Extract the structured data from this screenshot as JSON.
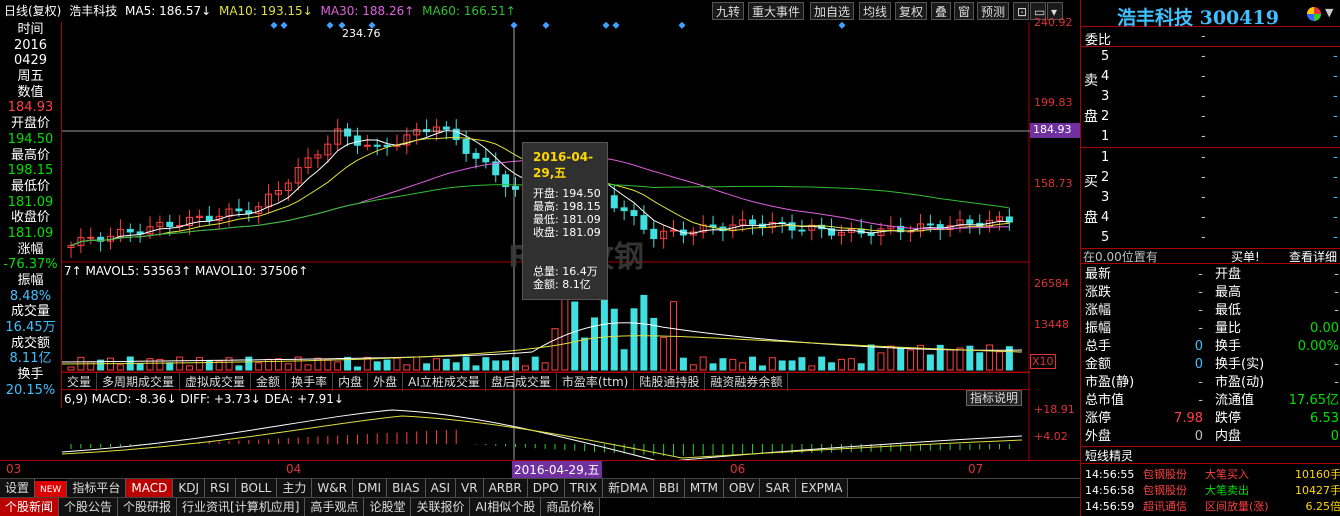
{
  "header": {
    "period": "日线(复权)",
    "stock": "浩丰科技",
    "ma5": "MA5: 186.57↓",
    "ma10": "MA10: 193.15↓",
    "ma30": "MA30: 188.26↑",
    "ma60": "MA60: 166.51↑",
    "toolbar": [
      "九转",
      "重大事件",
      "加自选",
      "均线",
      "复权",
      "叠",
      "窗",
      "预测"
    ]
  },
  "left_panel": {
    "lines": [
      {
        "text": "时间",
        "color": "#ffffff"
      },
      {
        "text": "2016",
        "color": "#ffffff"
      },
      {
        "text": "0429",
        "color": "#ffffff"
      },
      {
        "text": "周五",
        "color": "#ffffff"
      },
      {
        "text": "数值",
        "color": "#ffffff"
      },
      {
        "text": "184.93",
        "color": "#ff4040"
      },
      {
        "text": "开盘价",
        "color": "#ffffff"
      },
      {
        "text": "194.50",
        "color": "#00e000"
      },
      {
        "text": "最高价",
        "color": "#ffffff"
      },
      {
        "text": "198.15",
        "color": "#00e000"
      },
      {
        "text": "最低价",
        "color": "#ffffff"
      },
      {
        "text": "181.09",
        "color": "#00e000"
      },
      {
        "text": "收盘价",
        "color": "#ffffff"
      },
      {
        "text": "181.09",
        "color": "#00e000"
      },
      {
        "text": "涨幅",
        "color": "#ffffff"
      },
      {
        "text": "-76.37%",
        "color": "#00e000"
      },
      {
        "text": "振幅",
        "color": "#ffffff"
      },
      {
        "text": "8.48%",
        "color": "#40c0ff"
      },
      {
        "text": "成交量",
        "color": "#ffffff"
      },
      {
        "text": "16.45万",
        "color": "#40c0ff"
      },
      {
        "text": "成交额",
        "color": "#ffffff"
      },
      {
        "text": "8.11亿",
        "color": "#40c0ff"
      },
      {
        "text": "换手",
        "color": "#ffffff"
      },
      {
        "text": "20.15%",
        "color": "#40c0ff"
      }
    ]
  },
  "price_axis": [
    "240.92",
    "199.83",
    "184.93",
    "158.73"
  ],
  "high_label": "234.76",
  "volume_header": "7↑ MAVOL5: 53563↑ MAVOL10: 37506↑",
  "volume_axis": [
    "26584",
    "13448",
    "X10"
  ],
  "vol_tabs": [
    "交量",
    "多周期成交量",
    "虚拟成交量",
    "金额",
    "换手率",
    "内盘",
    "外盘",
    "AI立桩成交量",
    "盘后成交量",
    "市盈率(ttm)",
    "陆股通持股",
    "融资融券余额"
  ],
  "macd_header": "6,9) MACD: -8.36↓ DIFF: +3.73↓ DEA: +7.91↓",
  "macd_axis": [
    "+18.91",
    "+4.02"
  ],
  "indicator_btn": "指标说明",
  "date_axis": [
    "03",
    "04",
    "2016-04-29,五",
    "06",
    "07"
  ],
  "watermark": "RB螺纹钢",
  "tooltip": {
    "title": "2016-04-29,五",
    "rows": [
      "开盘: 194.50",
      "最高: 198.15",
      "最低: 181.09",
      "收盘: 181.09",
      "总量: 16.4万",
      "金额: 8.1亿"
    ]
  },
  "indicator_tabs": [
    "设置",
    "NEW",
    "指标平台",
    "MACD",
    "KDJ",
    "RSI",
    "BOLL",
    "主力",
    "W&R",
    "DMI",
    "BIAS",
    "ASI",
    "VR",
    "ARBR",
    "DPO",
    "TRIX",
    "新DMA",
    "BBI",
    "MTM",
    "OBV",
    "SAR",
    "EXPMA"
  ],
  "bottom_tabs": [
    "个股新闻",
    "个股公告",
    "个股研报",
    "行业资讯[计算机应用]",
    "高手观点",
    "论股堂",
    "关联报价",
    "AI相似个股",
    "商品价格"
  ],
  "right": {
    "title": "浩丰科技 300419",
    "weibi": "委比",
    "dash": "-",
    "sell_label": "卖盘",
    "buy_label": "买盘",
    "sell_levels": [
      "5",
      "4",
      "3",
      "2",
      "1"
    ],
    "buy_levels": [
      "1",
      "2",
      "3",
      "4",
      "5"
    ],
    "position_text": "在0.00位置有",
    "buy_order": "买单!",
    "detail": "查看详细",
    "quote_rows": [
      {
        "l": "最新",
        "lv": "-",
        "r": "开盘",
        "rv": "-",
        "rc": "#c0c0c0"
      },
      {
        "l": "涨跌",
        "lv": "-",
        "r": "最高",
        "rv": "-",
        "rc": "#c0c0c0"
      },
      {
        "l": "涨幅",
        "lv": "-",
        "r": "最低",
        "rv": "-",
        "rc": "#c0c0c0"
      },
      {
        "l": "振幅",
        "lv": "-",
        "r": "量比",
        "rv": "0.00",
        "rc": "#00e000"
      },
      {
        "l": "总手",
        "lv": "0",
        "r": "换手",
        "rv": "0.00%",
        "rc": "#00e000"
      },
      {
        "l": "金额",
        "lv": "0",
        "r": "换手(实)",
        "rv": "-",
        "rc": "#c0c0c0"
      },
      {
        "l": "市盈(静)",
        "lv": "-",
        "r": "市盈(动)",
        "rv": "-",
        "rc": "#c0c0c0"
      },
      {
        "l": "总市值",
        "lv": "-",
        "r": "流通值",
        "rv": "17.65亿",
        "rc": "#00e000"
      },
      {
        "l": "涨停",
        "lv": "7.98",
        "r": "跌停",
        "rv": "6.53",
        "rc": "#00e000"
      },
      {
        "l": "外盘",
        "lv": "0",
        "r": "内盘",
        "rv": "0",
        "rc": "#00e000"
      }
    ],
    "short_title": "短线精灵",
    "alerts": [
      {
        "time": "14:56:55",
        "name": "包钢股份",
        "type": "大笔买入",
        "vol": "10160手",
        "tc": "#ff4040"
      },
      {
        "time": "14:56:58",
        "name": "包钢股份",
        "type": "大笔卖出",
        "vol": "10427手",
        "tc": "#00e000"
      },
      {
        "time": "14:56:59",
        "name": "超讯通信",
        "type": "区间放量(涨)",
        "vol": "6.25倍",
        "tc": "#ff4040"
      }
    ]
  },
  "colors": {
    "up": "#ff4040",
    "down": "#40e0e0",
    "ma5": "#ffffff",
    "ma10": "#e0e040",
    "ma30": "#e060e0",
    "ma60": "#30c030"
  }
}
